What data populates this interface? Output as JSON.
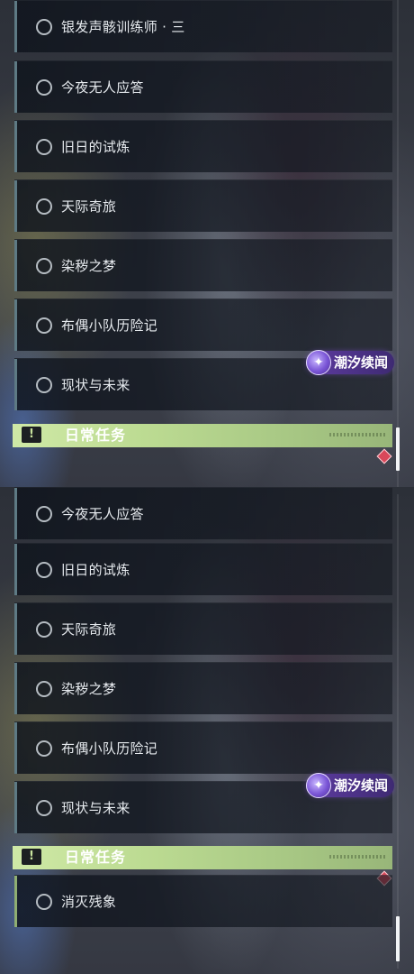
{
  "top_panel": {
    "items": [
      {
        "label": "银发声骸训练师 · 三"
      },
      {
        "label": "今夜无人应答"
      },
      {
        "label": "旧日的试炼"
      },
      {
        "label": "天际奇旅"
      },
      {
        "label": "染秽之梦"
      },
      {
        "label": "布偶小队历险记"
      },
      {
        "label": "现状与未来"
      }
    ],
    "section_header": {
      "title": "日常任务",
      "icon": "alert-icon",
      "icon_glyph": "!"
    },
    "watermark": {
      "text": "潮汐续闻",
      "logo_glyph": "✦"
    }
  },
  "bottom_panel": {
    "items": [
      {
        "label": "今夜无人应答"
      },
      {
        "label": "旧日的试炼"
      },
      {
        "label": "天际奇旅"
      },
      {
        "label": "染秽之梦"
      },
      {
        "label": "布偶小队历险记"
      },
      {
        "label": "现状与未来"
      }
    ],
    "section_header": {
      "title": "日常任务",
      "icon": "alert-icon",
      "icon_glyph": "!"
    },
    "daily_items": [
      {
        "label": "消灭残象"
      }
    ],
    "watermark": {
      "text": "潮汐续闻",
      "logo_glyph": "✦"
    }
  },
  "colors": {
    "section_header": "#bcdb92",
    "quest_marker": "#d9485a",
    "watermark": "#5e3ca1"
  }
}
